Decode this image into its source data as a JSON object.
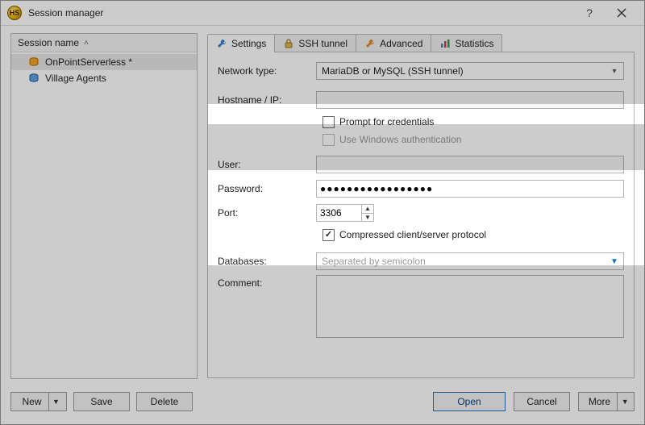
{
  "window": {
    "title": "Session manager",
    "help_tooltip": "?",
    "close_tooltip": "Close"
  },
  "sidebar": {
    "header_label": "Session name",
    "sort_dir": "asc",
    "items": [
      {
        "name": "OnPointServerless *",
        "selected": true,
        "icon": "db-orange-icon"
      },
      {
        "name": "Village Agents",
        "selected": false,
        "icon": "db-blue-icon"
      }
    ]
  },
  "tabs": [
    {
      "id": "settings",
      "label": "Settings",
      "icon": "wrench-icon",
      "active": true
    },
    {
      "id": "sshtunnel",
      "label": "SSH tunnel",
      "icon": "lock-icon",
      "active": false
    },
    {
      "id": "advanced",
      "label": "Advanced",
      "icon": "wrench2-icon",
      "active": false
    },
    {
      "id": "statistics",
      "label": "Statistics",
      "icon": "barchart-icon",
      "active": false
    }
  ],
  "form": {
    "network_type": {
      "label": "Network type:",
      "value": "MariaDB or MySQL (SSH tunnel)"
    },
    "hostname": {
      "label": "Hostname / IP:",
      "value": ""
    },
    "prompt_credentials": {
      "label": "Prompt for credentials",
      "checked": false
    },
    "use_windows_auth": {
      "label": "Use Windows authentication",
      "checked": false,
      "disabled": true
    },
    "user": {
      "label": "User:",
      "value": ""
    },
    "password": {
      "label": "Password:",
      "value": "●●●●●●●●●●●●●●●●●"
    },
    "port": {
      "label": "Port:",
      "value": "3306"
    },
    "compressed": {
      "label": "Compressed client/server protocol",
      "checked": true
    },
    "databases": {
      "label": "Databases:",
      "placeholder": "Separated by semicolon",
      "value": ""
    },
    "comment": {
      "label": "Comment:",
      "value": ""
    }
  },
  "buttons": {
    "new": "New",
    "save": "Save",
    "delete": "Delete",
    "open": "Open",
    "cancel": "Cancel",
    "more": "More"
  }
}
